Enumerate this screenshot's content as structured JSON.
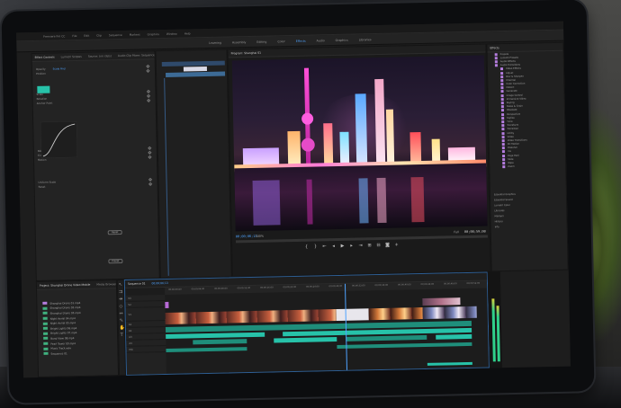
{
  "menubar": {
    "items": [
      "Premiere Pro CC",
      "File",
      "Edit",
      "Clip",
      "Sequence",
      "Markers",
      "Graphics",
      "Window",
      "Help"
    ]
  },
  "workspaces": {
    "tabs": [
      "Learning",
      "Assembly",
      "Editing",
      "Color",
      "Effects",
      "Audio",
      "Graphics",
      "Libraries"
    ],
    "active_index": 4
  },
  "effect_controls": {
    "tabs": [
      "Effect Controls",
      "Lumetri Scopes",
      "Source: (no clips)",
      "Audio Clip Mixer: Sequence 01"
    ],
    "rows": [
      "Opacity",
      "Position",
      "Scale",
      "Rotation",
      "Anchor Point",
      "Blend Mode",
      "Time Remapping",
      "Motion",
      "Uniform Scale",
      "Reset"
    ],
    "value": "Scale Rnd",
    "buttons": [
      "Reset",
      "Preset"
    ]
  },
  "program_monitor": {
    "tab": "Program: Shanghai 01",
    "timecode": "00;00;06;13",
    "fit": "100%",
    "quality": "Full",
    "duration": "00;00;59;00"
  },
  "effects": {
    "title": "Effects",
    "items": [
      "Presets",
      "Lumetri Presets",
      "Audio Effects",
      "Audio Transitions",
      "Video Effects",
      "Adjust",
      "Blur & Sharpen",
      "Channel",
      "Color Correction",
      "Distort",
      "Generate",
      "Image Control",
      "Immersive Video",
      "Keying",
      "Noise & Grain",
      "Obsolete",
      "Perspective",
      "Stylize",
      "Time",
      "Transform",
      "Transition",
      "Utility",
      "Video",
      "Video Transitions",
      "3D Motion",
      "Dissolve",
      "Iris",
      "Page Peel",
      "Slide",
      "Wipe",
      "Zoom"
    ],
    "bottom": [
      "Essential Graphics",
      "Essential Sound",
      "Lumetri Color",
      "Libraries",
      "Markers",
      "History",
      "Info"
    ]
  },
  "project": {
    "tabs": [
      "Project: Shanghai Drone Video Mobile",
      "Media Browser"
    ],
    "items": [
      "Shanghai Drone 01.mp4",
      "Shanghai Drone 02.mp4",
      "Shanghai Drone 03.mp4",
      "Night Aerial 04.mp4",
      "Night Aerial 05.mp4",
      "Bright Lights 06.mp4",
      "Bright Lights 07.mp4",
      "Bund View 08.mp4",
      "Pearl Tower 09.mp4",
      "Music Track.wav",
      "Sequence 01"
    ]
  },
  "timeline": {
    "tab": "Sequence 01",
    "timecode": "00;00;06;13",
    "ruler": [
      "00;00;00;00",
      "00;00;04;00",
      "00;00;08;00",
      "00;00;12;00",
      "00;00;16;00",
      "00;00;20;00",
      "00;00;24;00",
      "00;00;28;00",
      "00;00;32;00",
      "00;00;36;00",
      "00;00;40;00",
      "00;00;44;00",
      "00;00;48;00",
      "00;00;52;00"
    ],
    "tracks": [
      "V3",
      "V2",
      "V1",
      "A1",
      "A2",
      "A3",
      "A4",
      "Mix"
    ]
  },
  "colors": {
    "accent": "#4fa3ff",
    "audio": "#27c2a9",
    "purple": "#b57de0"
  }
}
